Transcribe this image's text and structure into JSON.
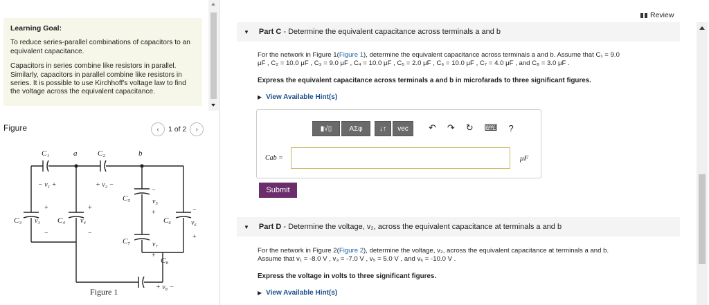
{
  "learning_goal": {
    "title": "Learning Goal:",
    "p1": "To reduce series-parallel combinations of capacitors to an equivalent capacitance.",
    "p2": "Capacitors in series combine like resistors in parallel. Similarly, capacitors in parallel combine like resistors in series. It is possible to use Kirchhoff's voltage law to find the voltage across the equivalent capacitance."
  },
  "figure": {
    "label": "Figure",
    "pager_text": "1 of 2",
    "prev_glyph": "‹",
    "next_glyph": "›",
    "caption": "Figure 1",
    "labels": {
      "C1": "C₁",
      "C2": "C₂",
      "C3": "C₃",
      "C4": "C₄",
      "C5": "C₅",
      "C6": "C₆",
      "C7": "C₇",
      "C8": "C₈",
      "a": "a",
      "b": "b",
      "v1": "− v₁ +",
      "v2": "+ v₂ −",
      "v3": "v₃",
      "v4": "v₄",
      "v5": "v₅",
      "v6": "v₆",
      "v7": "v₇",
      "v8": "+ v₈ −",
      "plus": "+",
      "minus": "−"
    }
  },
  "review": "Review",
  "part_c": {
    "caret": "▼",
    "title_prefix": "Part C",
    "title_rest": " - Determine the equivalent capacitance across terminals a and b",
    "text_1a": "For the network in Figure 1(",
    "text_1_link": "Figure 1",
    "text_1b": "), determine the equivalent capacitance across terminals a and b. Assume that C₁ = 9.0",
    "text_2": "μF , C₂ = 10.0 μF , C₃ = 9.0 μF , C₄ = 10.0 μF , C₅ = 2.0 μF , C₆ = 10.0 μF , C₇ = 4.0 μF , and C₈ = 3.0 μF .",
    "instruction": "Express the equivalent capacitance across terminals a and b in microfarads to three significant figures.",
    "hint": "View Available Hint(s)",
    "answer_label": "Cab =",
    "answer_unit": "μF",
    "answer_value": "",
    "submit": "Submit",
    "toolbar": {
      "templates": "▮√▯",
      "greek": "ΑΣφ",
      "arrows": "↓↑",
      "vec": "vec",
      "undo": "↶",
      "redo": "↷",
      "reset": "↻",
      "keyboard": "⌨",
      "help": "?"
    }
  },
  "part_d": {
    "caret": "▼",
    "title_prefix": "Part D",
    "title_rest": " - Determine the voltage, v₂, across the equivalent capacitance at terminals a and b",
    "text_1a": "For the network in Figure 2(",
    "text_1_link": "Figure 2",
    "text_1b": "), determine the voltage, v₂, across the equivalent capacitance at terminals a and b.",
    "text_2": "Assume that v₁ = -8.0 V , v₃ = -7.0 V , v₅ = 5.0 V , and v₆ = -10.0 V .",
    "instruction": "Express the voltage in volts to three significant figures.",
    "hint": "View Available Hint(s)"
  }
}
